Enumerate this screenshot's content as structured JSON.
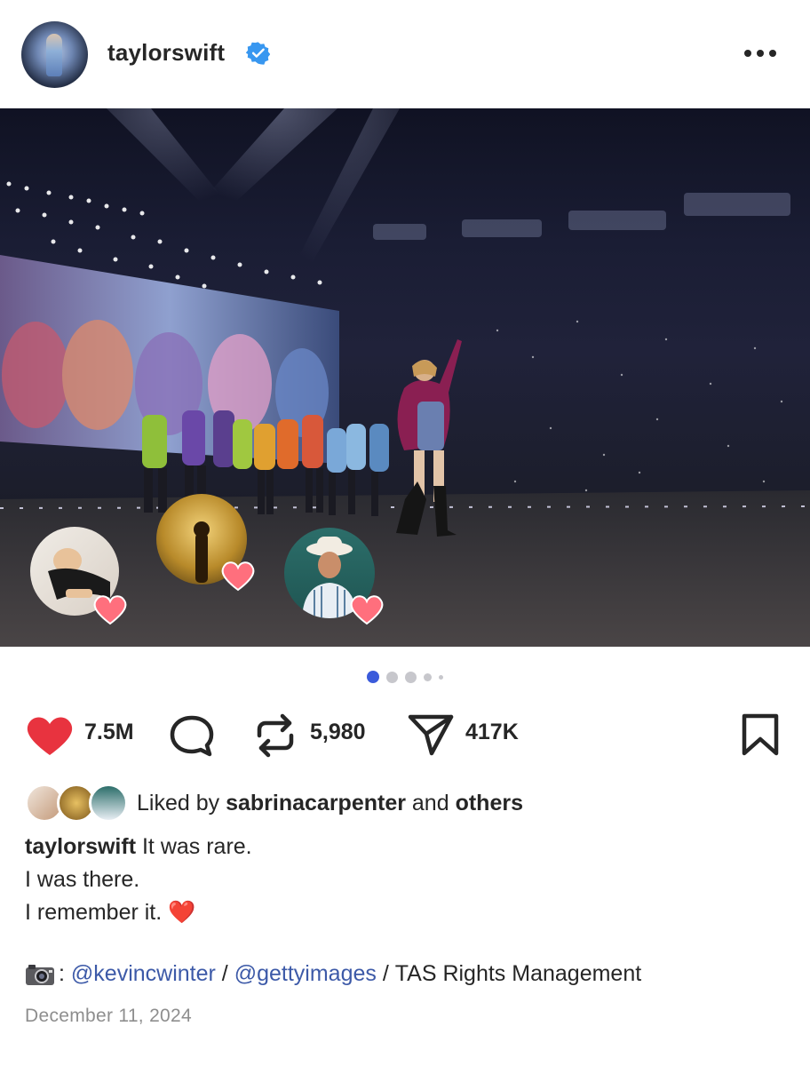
{
  "post": {
    "username": "taylorswift",
    "verified": true,
    "image_alt_objects": [
      "stage-performer",
      "dancers",
      "stadium-screen",
      "crowd-lights"
    ],
    "carousel": {
      "total": 5,
      "active": 1
    },
    "reactions": [
      "reaction-avatar-1",
      "reaction-avatar-2",
      "reaction-avatar-3"
    ],
    "actions": {
      "likes_count": "7.5M",
      "reposts_count": "5,980",
      "shares_count": "417K"
    },
    "liked_by": {
      "prefix": "Liked by",
      "user": "sabrinacarpenter",
      "conjunction": "and",
      "others": "others"
    },
    "caption": {
      "author": "taylorswift",
      "line1": "It was rare.",
      "line2": "I was there.",
      "line3": "I remember it.",
      "emoji": "❤️"
    },
    "credit": {
      "separator_colon": ":",
      "handle1": "@kevincwinter",
      "slash": "/",
      "handle2": "@gettyimages",
      "rest": "TAS Rights Management"
    },
    "date": "December 11, 2024"
  },
  "colors": {
    "like_red": "#e8333f",
    "verified_blue": "#3897f0",
    "link_blue": "#3d5aa8",
    "dot_active": "#3b5bdb"
  }
}
